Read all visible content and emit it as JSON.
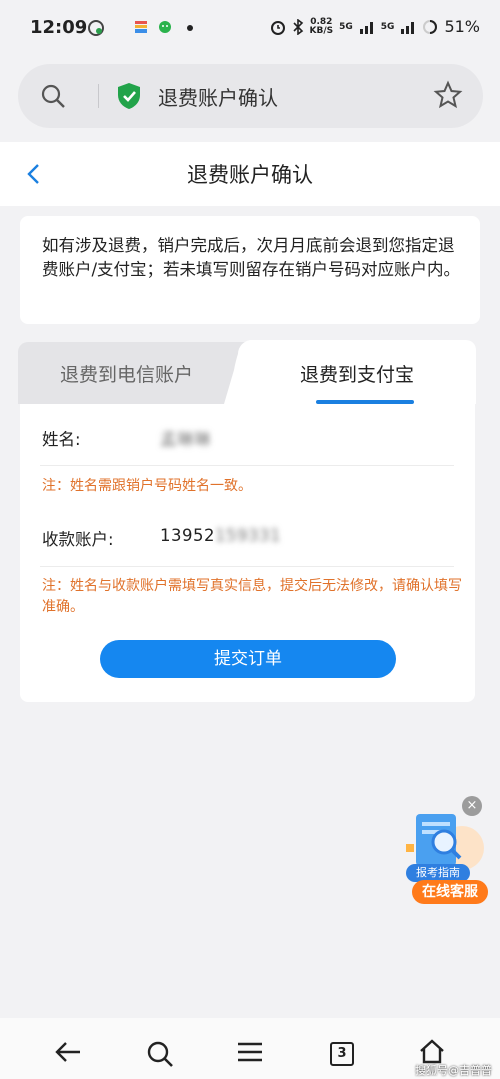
{
  "status_bar": {
    "time": "12:09",
    "net_speed_value": "0.82",
    "net_speed_unit": "KB/S",
    "signal1": "5G",
    "signal2": "5G",
    "battery": "51%",
    "icons": [
      "chat-bubble-icon",
      "wallet-icon",
      "wechat-icon",
      "dot-icon",
      "alarm-icon",
      "bluetooth-icon",
      "signal-icon",
      "signal-icon",
      "battery-icon"
    ]
  },
  "url_bar": {
    "title": "退费账户确认",
    "icons": [
      "search-icon",
      "shield-check-icon",
      "star-icon"
    ]
  },
  "header": {
    "title": "退费账户确认",
    "back_icon": "chevron-left-icon"
  },
  "notice": {
    "text": "如有涉及退费，销户完成后，次月月底前会退到您指定退费账户/支付宝；若未填写则留存在销户号码对应账户内。"
  },
  "tabs": [
    {
      "label": "退费到电信账户",
      "active": false
    },
    {
      "label": "退费到支付宝",
      "active": true
    }
  ],
  "form": {
    "name_label": "姓名:",
    "name_value": "孟琳琳",
    "name_note": "注：姓名需跟销户号码姓名一致。",
    "account_label": "收款账户:",
    "account_visible": "13952",
    "account_blurred": "159331",
    "account_note": "注：姓名与收款账户需填写真实信息，提交后无法修改，请确认填写准确。",
    "submit_label": "提交订单"
  },
  "float_widget": {
    "close": "×",
    "label1": "报考指南",
    "label2": "在线客服"
  },
  "bottom_nav": {
    "tab_count": "3",
    "watermark": "搜狐号@吉普普",
    "icons": [
      "arrow-left-icon",
      "search-icon",
      "menu-icon",
      "tabs-icon",
      "home-icon"
    ]
  },
  "colors": {
    "accent": "#1587f0",
    "warning": "#e0722b",
    "secure_green": "#22a34a",
    "service_orange": "#ff7a1a"
  }
}
